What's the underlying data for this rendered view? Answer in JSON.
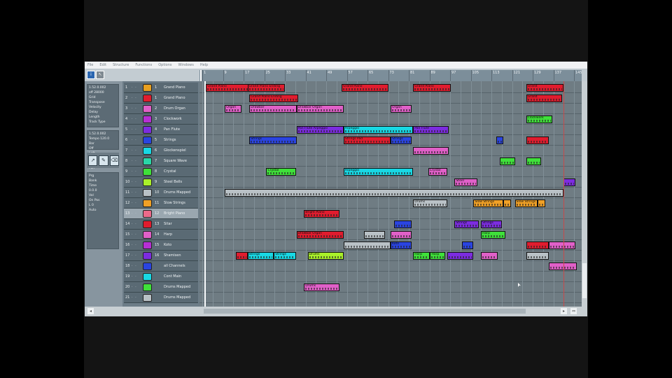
{
  "menu": [
    "File",
    "Edit",
    "Structure",
    "Functions",
    "Options",
    "Windows",
    "Help"
  ],
  "colors": {
    "red": "#e01c2e",
    "pink": "#e060c8",
    "magenta": "#b62fd4",
    "purple": "#7c2ce0",
    "blue": "#2a44e0",
    "cyan": "#18d8e4",
    "green": "#3fe03a",
    "lime": "#a9f02a",
    "orange": "#f0a026",
    "teal": "#2ad6a8",
    "rose": "#ec6a8a",
    "grey": "#b9c1c6",
    "blue2": "#3c5cf0"
  },
  "inspector": {
    "info_lines": [
      "1.52.0.002",
      "off 28000",
      "Grid",
      "Transpose",
      "Velocity",
      "Delay",
      "Length",
      "Track Type"
    ],
    "value_lines": [
      "1.52.0.002",
      "Tempo 120.0",
      "Bar",
      "Off",
      "Left",
      "Out",
      "Vol",
      "Pan"
    ],
    "pad_lines": [
      "Prg",
      "Bank",
      "Time",
      "0.0.0",
      "Vol",
      "On Pos",
      "L 0",
      "Auto"
    ]
  },
  "tracks": [
    {
      "n": "1",
      "ch": "1",
      "name": "Grand Piano",
      "color": "#e8a020"
    },
    {
      "n": "2",
      "ch": "1",
      "name": "Grand Piano",
      "color": "#e01c2e"
    },
    {
      "n": "3",
      "ch": "2",
      "name": "Drum Organ",
      "color": "#e060c8"
    },
    {
      "n": "4",
      "ch": "3",
      "name": "Clockwork",
      "color": "#b62fd4"
    },
    {
      "n": "5",
      "ch": "4",
      "name": "Pan Flute",
      "color": "#7c2ce0"
    },
    {
      "n": "6",
      "ch": "5",
      "name": "Strings",
      "color": "#2a44e0"
    },
    {
      "n": "7",
      "ch": "6",
      "name": "Glockenspiel",
      "color": "#18d8e4"
    },
    {
      "n": "8",
      "ch": "7",
      "name": "Square Wave",
      "color": "#2ad6a8"
    },
    {
      "n": "9",
      "ch": "8",
      "name": "Crystal",
      "color": "#3fe03a"
    },
    {
      "n": "10",
      "ch": "9",
      "name": "Steel Bells",
      "color": "#a9f02a"
    },
    {
      "n": "11",
      "ch": "10",
      "name": "Drums Mapped",
      "color": "#b9c1c6"
    },
    {
      "n": "12",
      "ch": "11",
      "name": "Slow Strings",
      "color": "#f0a026"
    },
    {
      "n": "13",
      "ch": "12",
      "name": "Bright Piano",
      "color": "#ec6a8a"
    },
    {
      "n": "14",
      "ch": "13",
      "name": "Sitar",
      "color": "#e01c2e"
    },
    {
      "n": "15",
      "ch": "14",
      "name": "Harp",
      "color": "#e060c8"
    },
    {
      "n": "16",
      "ch": "15",
      "name": "Koto",
      "color": "#b62fd4"
    },
    {
      "n": "17",
      "ch": "16",
      "name": "Shamisen",
      "color": "#7c2ce0"
    },
    {
      "n": "18",
      "ch": "",
      "name": "all Channels",
      "color": "#2a44e0"
    },
    {
      "n": "19",
      "ch": "",
      "name": "Cont Main",
      "color": "#18d8e4"
    },
    {
      "n": "20",
      "ch": "",
      "name": "Drums Mapped",
      "color": "#3fe03a"
    },
    {
      "n": "21",
      "ch": "",
      "name": "Drums Mapped",
      "color": "#b9c1c6"
    }
  ],
  "ruler": [
    "1",
    "9",
    "17",
    "25",
    "33",
    "41",
    "49",
    "57",
    "65",
    "73",
    "81",
    "89",
    "97",
    "105",
    "113",
    "121",
    "129",
    "137",
    "145"
  ],
  "selected_track": 12,
  "parts": [
    {
      "lane": 0,
      "start": 0.01,
      "len": 0.115,
      "color": "#e01c2e",
      "label": "Grand Piano"
    },
    {
      "lane": 0,
      "start": 0.12,
      "len": 0.1,
      "color": "#e01c2e",
      "label": "Grand Piano Ending"
    },
    {
      "lane": 0,
      "start": 0.37,
      "len": 0.125,
      "color": "#e01c2e",
      "label": "Grand Piano"
    },
    {
      "lane": 0,
      "start": 0.56,
      "len": 0.1,
      "color": "#e01c2e",
      "label": "Grand Piano"
    },
    {
      "lane": 0,
      "start": 0.86,
      "len": 0.1,
      "color": "#e01c2e",
      "label": "Grand"
    },
    {
      "lane": 1,
      "start": 0.125,
      "len": 0.13,
      "color": "#e01c2e",
      "label": "Grand Piano Ending"
    },
    {
      "lane": 1,
      "start": 0.86,
      "len": 0.095,
      "color": "#e01c2e",
      "label": "Grand"
    },
    {
      "lane": 2,
      "start": 0.06,
      "len": 0.045,
      "color": "#e060c8",
      "label": "Organ"
    },
    {
      "lane": 2,
      "start": 0.125,
      "len": 0.125,
      "color": "#e060c8",
      "label": "Drawbar"
    },
    {
      "lane": 2,
      "start": 0.25,
      "len": 0.125,
      "color": "#e060c8",
      "label": "Drawbar Organ"
    },
    {
      "lane": 2,
      "start": 0.5,
      "len": 0.055,
      "color": "#e060c8",
      "label": "Organ"
    },
    {
      "lane": 3,
      "start": 0.86,
      "len": 0.07,
      "color": "#3fe03a",
      "label": "Clockwork"
    },
    {
      "lane": 4,
      "start": 0.25,
      "len": 0.125,
      "color": "#7c2ce0",
      "label": "Pan Flute Arpeggio"
    },
    {
      "lane": 4,
      "start": 0.375,
      "len": 0.185,
      "color": "#18d8e4",
      "label": "Arpeggio"
    },
    {
      "lane": 4,
      "start": 0.56,
      "len": 0.095,
      "color": "#7c2ce0",
      "label": "Pan Flute"
    },
    {
      "lane": 5,
      "start": 0.125,
      "len": 0.125,
      "color": "#2a44e0",
      "label": "Strings"
    },
    {
      "lane": 5,
      "start": 0.375,
      "len": 0.125,
      "color": "#e01c2e",
      "label": "Strings Pad"
    },
    {
      "lane": 5,
      "start": 0.5,
      "len": 0.055,
      "color": "#2a44e0",
      "label": "Strings"
    },
    {
      "lane": 5,
      "start": 0.78,
      "len": 0.02,
      "color": "#2a44e0",
      "label": ""
    },
    {
      "lane": 5,
      "start": 0.86,
      "len": 0.06,
      "color": "#e01c2e",
      "label": ""
    },
    {
      "lane": 6,
      "start": 0.56,
      "len": 0.095,
      "color": "#e060c8",
      "label": ""
    },
    {
      "lane": 7,
      "start": 0.79,
      "len": 0.04,
      "color": "#3fe03a",
      "label": ""
    },
    {
      "lane": 7,
      "start": 0.86,
      "len": 0.04,
      "color": "#3fe03a",
      "label": ""
    },
    {
      "lane": 8,
      "start": 0.17,
      "len": 0.08,
      "color": "#3fe03a",
      "label": "Crystal"
    },
    {
      "lane": 8,
      "start": 0.375,
      "len": 0.185,
      "color": "#18d8e4",
      "label": "Arpeggio"
    },
    {
      "lane": 8,
      "start": 0.6,
      "len": 0.05,
      "color": "#e060c8",
      "label": "Crystal"
    },
    {
      "lane": 9,
      "start": 0.67,
      "len": 0.06,
      "color": "#e060c8",
      "label": "Steel"
    },
    {
      "lane": 9,
      "start": 0.96,
      "len": 0.03,
      "color": "#7c2ce0",
      "label": ""
    },
    {
      "lane": 10,
      "start": 0.06,
      "len": 0.9,
      "color": "#b9c1c6",
      "label": ""
    },
    {
      "lane": 11,
      "start": 0.56,
      "len": 0.09,
      "color": "#b9c1c6",
      "label": "Drums"
    },
    {
      "lane": 11,
      "start": 0.72,
      "len": 0.08,
      "color": "#f0a026",
      "label": "Slow Strings"
    },
    {
      "lane": 11,
      "start": 0.8,
      "len": 0.02,
      "color": "#f0a026",
      "label": ""
    },
    {
      "lane": 11,
      "start": 0.83,
      "len": 0.06,
      "color": "#f0a026",
      "label": "Slow Strings"
    },
    {
      "lane": 11,
      "start": 0.89,
      "len": 0.02,
      "color": "#f0a026",
      "label": ""
    },
    {
      "lane": 12,
      "start": 0.27,
      "len": 0.095,
      "color": "#e01c2e",
      "label": "Bright Piano"
    },
    {
      "lane": 13,
      "start": 0.51,
      "len": 0.045,
      "color": "#2a44e0",
      "label": ""
    },
    {
      "lane": 13,
      "start": 0.67,
      "len": 0.065,
      "color": "#7c2ce0",
      "label": "Strings"
    },
    {
      "lane": 13,
      "start": 0.74,
      "len": 0.055,
      "color": "#7c2ce0",
      "label": "Strings"
    },
    {
      "lane": 14,
      "start": 0.25,
      "len": 0.125,
      "color": "#e01c2e",
      "label": "Drawbar Organ"
    },
    {
      "lane": 14,
      "start": 0.43,
      "len": 0.055,
      "color": "#b9c1c6",
      "label": ""
    },
    {
      "lane": 14,
      "start": 0.5,
      "len": 0.055,
      "color": "#e060c8",
      "label": ""
    },
    {
      "lane": 14,
      "start": 0.74,
      "len": 0.065,
      "color": "#3fe03a",
      "label": "Harp"
    },
    {
      "lane": 15,
      "start": 0.375,
      "len": 0.125,
      "color": "#b9c1c6",
      "label": ""
    },
    {
      "lane": 15,
      "start": 0.5,
      "len": 0.055,
      "color": "#2a44e0",
      "label": "Koto"
    },
    {
      "lane": 15,
      "start": 0.69,
      "len": 0.03,
      "color": "#2a44e0",
      "label": ""
    },
    {
      "lane": 15,
      "start": 0.86,
      "len": 0.06,
      "color": "#e01c2e",
      "label": ""
    },
    {
      "lane": 15,
      "start": 0.92,
      "len": 0.07,
      "color": "#e060c8",
      "label": ""
    },
    {
      "lane": 16,
      "start": 0.09,
      "len": 0.03,
      "color": "#e01c2e",
      "label": ""
    },
    {
      "lane": 16,
      "start": 0.12,
      "len": 0.07,
      "color": "#18d8e4",
      "label": "Strings"
    },
    {
      "lane": 16,
      "start": 0.19,
      "len": 0.06,
      "color": "#18d8e4",
      "label": "Strings"
    },
    {
      "lane": 16,
      "start": 0.28,
      "len": 0.095,
      "color": "#a9f02a",
      "label": "Drums"
    },
    {
      "lane": 16,
      "start": 0.56,
      "len": 0.045,
      "color": "#3fe03a",
      "label": "Harp"
    },
    {
      "lane": 16,
      "start": 0.605,
      "len": 0.04,
      "color": "#3fe03a",
      "label": "Harp"
    },
    {
      "lane": 16,
      "start": 0.65,
      "len": 0.07,
      "color": "#7c2ce0",
      "label": ""
    },
    {
      "lane": 16,
      "start": 0.74,
      "len": 0.045,
      "color": "#e060c8",
      "label": ""
    },
    {
      "lane": 16,
      "start": 0.86,
      "len": 0.06,
      "color": "#b9c1c6",
      "label": ""
    },
    {
      "lane": 17,
      "start": 0.92,
      "len": 0.075,
      "color": "#e060c8",
      "label": ""
    },
    {
      "lane": 19,
      "start": 0.27,
      "len": 0.095,
      "color": "#e060c8",
      "label": "Drums"
    }
  ]
}
